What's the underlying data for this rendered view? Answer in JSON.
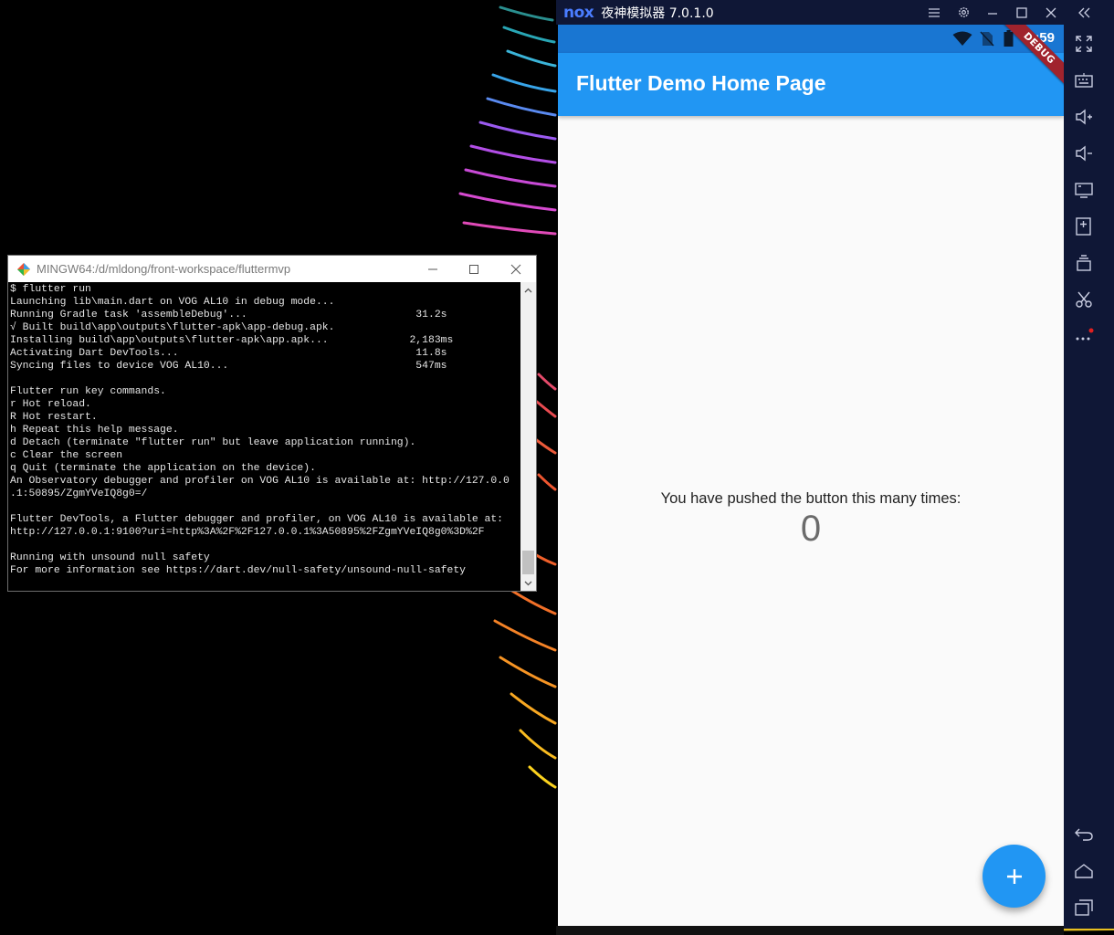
{
  "terminal": {
    "title": "MINGW64:/d/mldong/front-workspace/fluttermvp",
    "lines": [
      "$ flutter run",
      "Launching lib\\main.dart on VOG AL10 in debug mode...",
      "Running Gradle task 'assembleDebug'...                           31.2s",
      "√ Built build\\app\\outputs\\flutter-apk\\app-debug.apk.",
      "Installing build\\app\\outputs\\flutter-apk\\app.apk...             2,183ms",
      "Activating Dart DevTools...                                      11.8s",
      "Syncing files to device VOG AL10...                              547ms",
      "",
      "Flutter run key commands.",
      "r Hot reload.",
      "R Hot restart.",
      "h Repeat this help message.",
      "d Detach (terminate \"flutter run\" but leave application running).",
      "c Clear the screen",
      "q Quit (terminate the application on the device).",
      "An Observatory debugger and profiler on VOG AL10 is available at: http://127.0.0",
      ".1:50895/ZgmYVeIQ8g0=/",
      "",
      "Flutter DevTools, a Flutter debugger and profiler, on VOG AL10 is available at:",
      "http://127.0.0.1:9100?uri=http%3A%2F%2F127.0.0.1%3A50895%2FZgmYVeIQ8g0%3D%2F",
      "",
      "Running with unsound null safety",
      "For more information see https://dart.dev/null-safety/unsound-null-safety",
      ""
    ]
  },
  "emulator": {
    "logo": "nox",
    "title": "夜神模拟器 7.0.1.0",
    "status_time": "4:59",
    "debug_banner": "DEBUG",
    "app": {
      "title": "Flutter Demo Home Page",
      "message": "You have pushed the button this many times:",
      "counter": "0",
      "fab_icon": "plus-icon"
    },
    "sidebar_icons": [
      "fullscreen-icon",
      "keyboard-icon",
      "volume-up-icon",
      "volume-down-icon",
      "screen-icon",
      "install-apk-icon",
      "multi-instance-icon",
      "screenshot-scissors-icon",
      "more-icon",
      "back-icon",
      "home-icon",
      "recents-icon"
    ]
  },
  "colors": {
    "appbar": "#2196f3",
    "statusbar": "#1976d2",
    "debug": "#a0232d",
    "nox_frame": "#0f1736"
  }
}
